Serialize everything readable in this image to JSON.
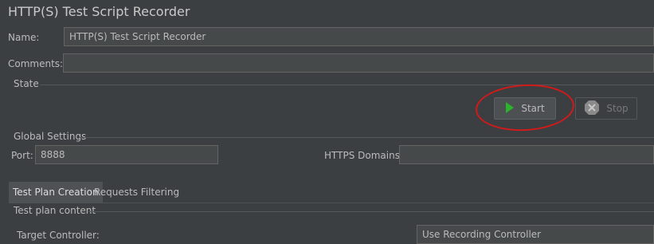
{
  "window": {
    "title": "HTTP(S) Test Script Recorder"
  },
  "form": {
    "name_label": "Name:",
    "name_value": "HTTP(S) Test Script Recorder",
    "comments_label": "Comments:",
    "comments_value": ""
  },
  "state": {
    "heading": "State",
    "start_label": "Start",
    "stop_label": "Stop",
    "start_icon": "play-icon",
    "stop_icon": "stop-icon",
    "highlight_color": "#d11a1a"
  },
  "global_settings": {
    "heading": "Global Settings",
    "port_label": "Port:",
    "port_value": "8888",
    "https_domains_label": "HTTPS Domains:",
    "https_domains_value": ""
  },
  "tabs": [
    {
      "label": "Test Plan Creation",
      "active": true
    },
    {
      "label": "Requests Filtering",
      "active": false
    }
  ],
  "test_plan": {
    "heading": "Test plan content",
    "target_controller_label": "Target Controller:",
    "target_controller_value": "Use Recording Controller"
  }
}
